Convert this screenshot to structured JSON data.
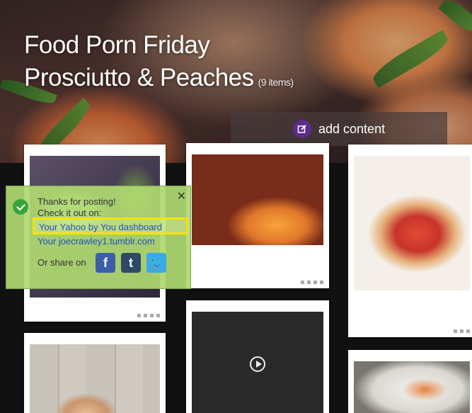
{
  "header": {
    "title_line1": "Food Porn Friday",
    "title_line2": "Prosciutto & Peaches",
    "item_count": "(9 items)",
    "add_content_label": "add content"
  },
  "popup": {
    "line1": "Thanks for posting!",
    "line2": "Check it out on:",
    "link_yahoo": "Your Yahoo by You dashboard",
    "link_tumblr": "Your joecrawley1.tumblr.com",
    "share_label": "Or share on",
    "close_glyph": "✕",
    "facebook_glyph": "f",
    "tumblr_glyph": "t",
    "twitter_glyph": "🐦"
  },
  "colors": {
    "popup_bg": "#aed870",
    "highlight": "#f4e600",
    "link": "#2450b8",
    "add_icon": "#5b2d8c"
  }
}
